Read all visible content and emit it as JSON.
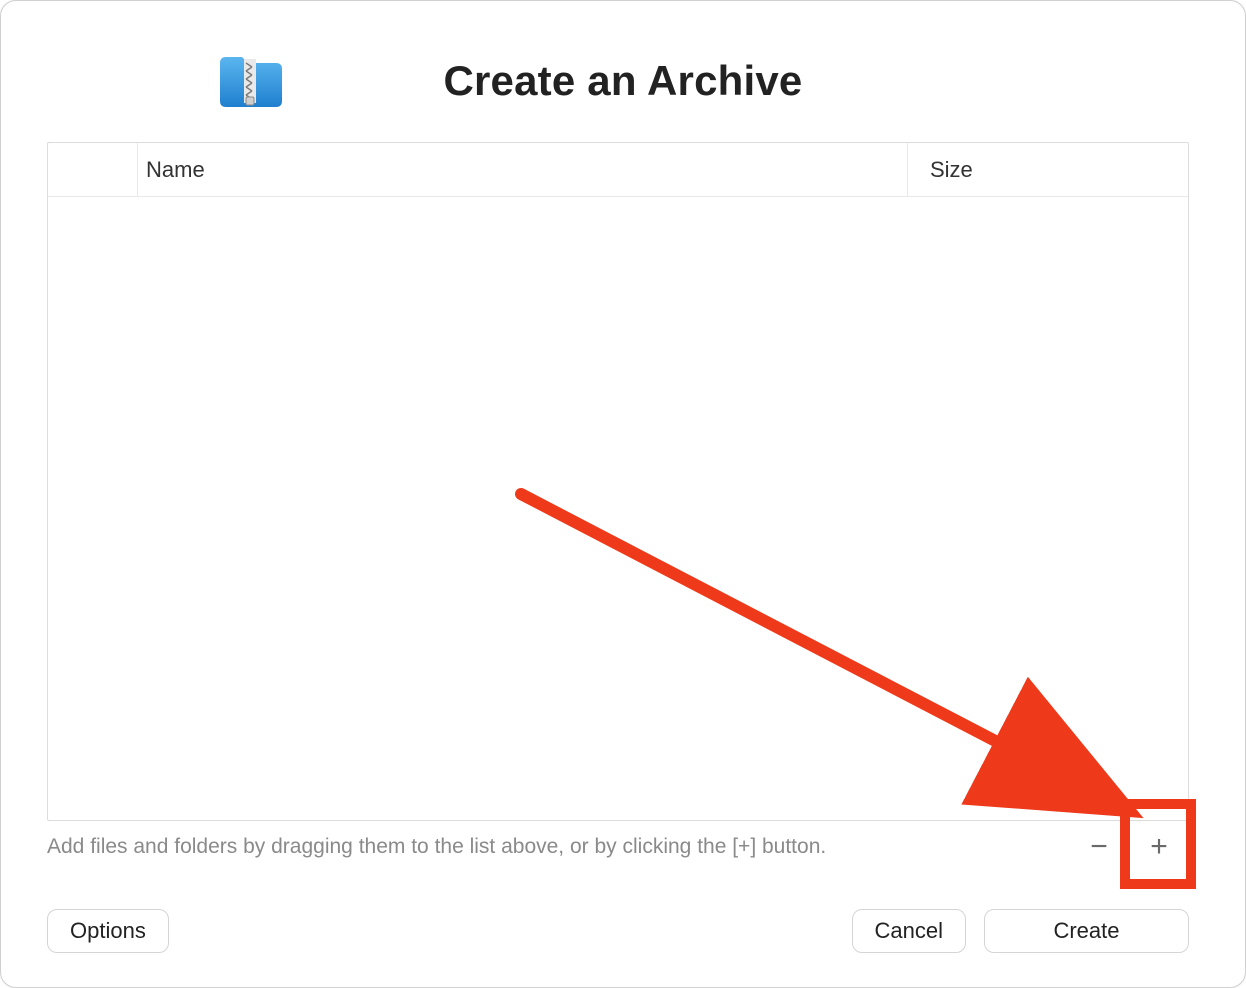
{
  "header": {
    "title": "Create an Archive"
  },
  "table": {
    "columns": {
      "name": "Name",
      "size": "Size"
    },
    "rows": []
  },
  "hint": "Add files and folders by dragging them to the list above, or by clicking the [+] button.",
  "controls": {
    "remove_label": "−",
    "add_label": "+"
  },
  "footer": {
    "options_label": "Options",
    "cancel_label": "Cancel",
    "create_label": "Create"
  },
  "annotation": {
    "color": "#ee3a1b"
  }
}
